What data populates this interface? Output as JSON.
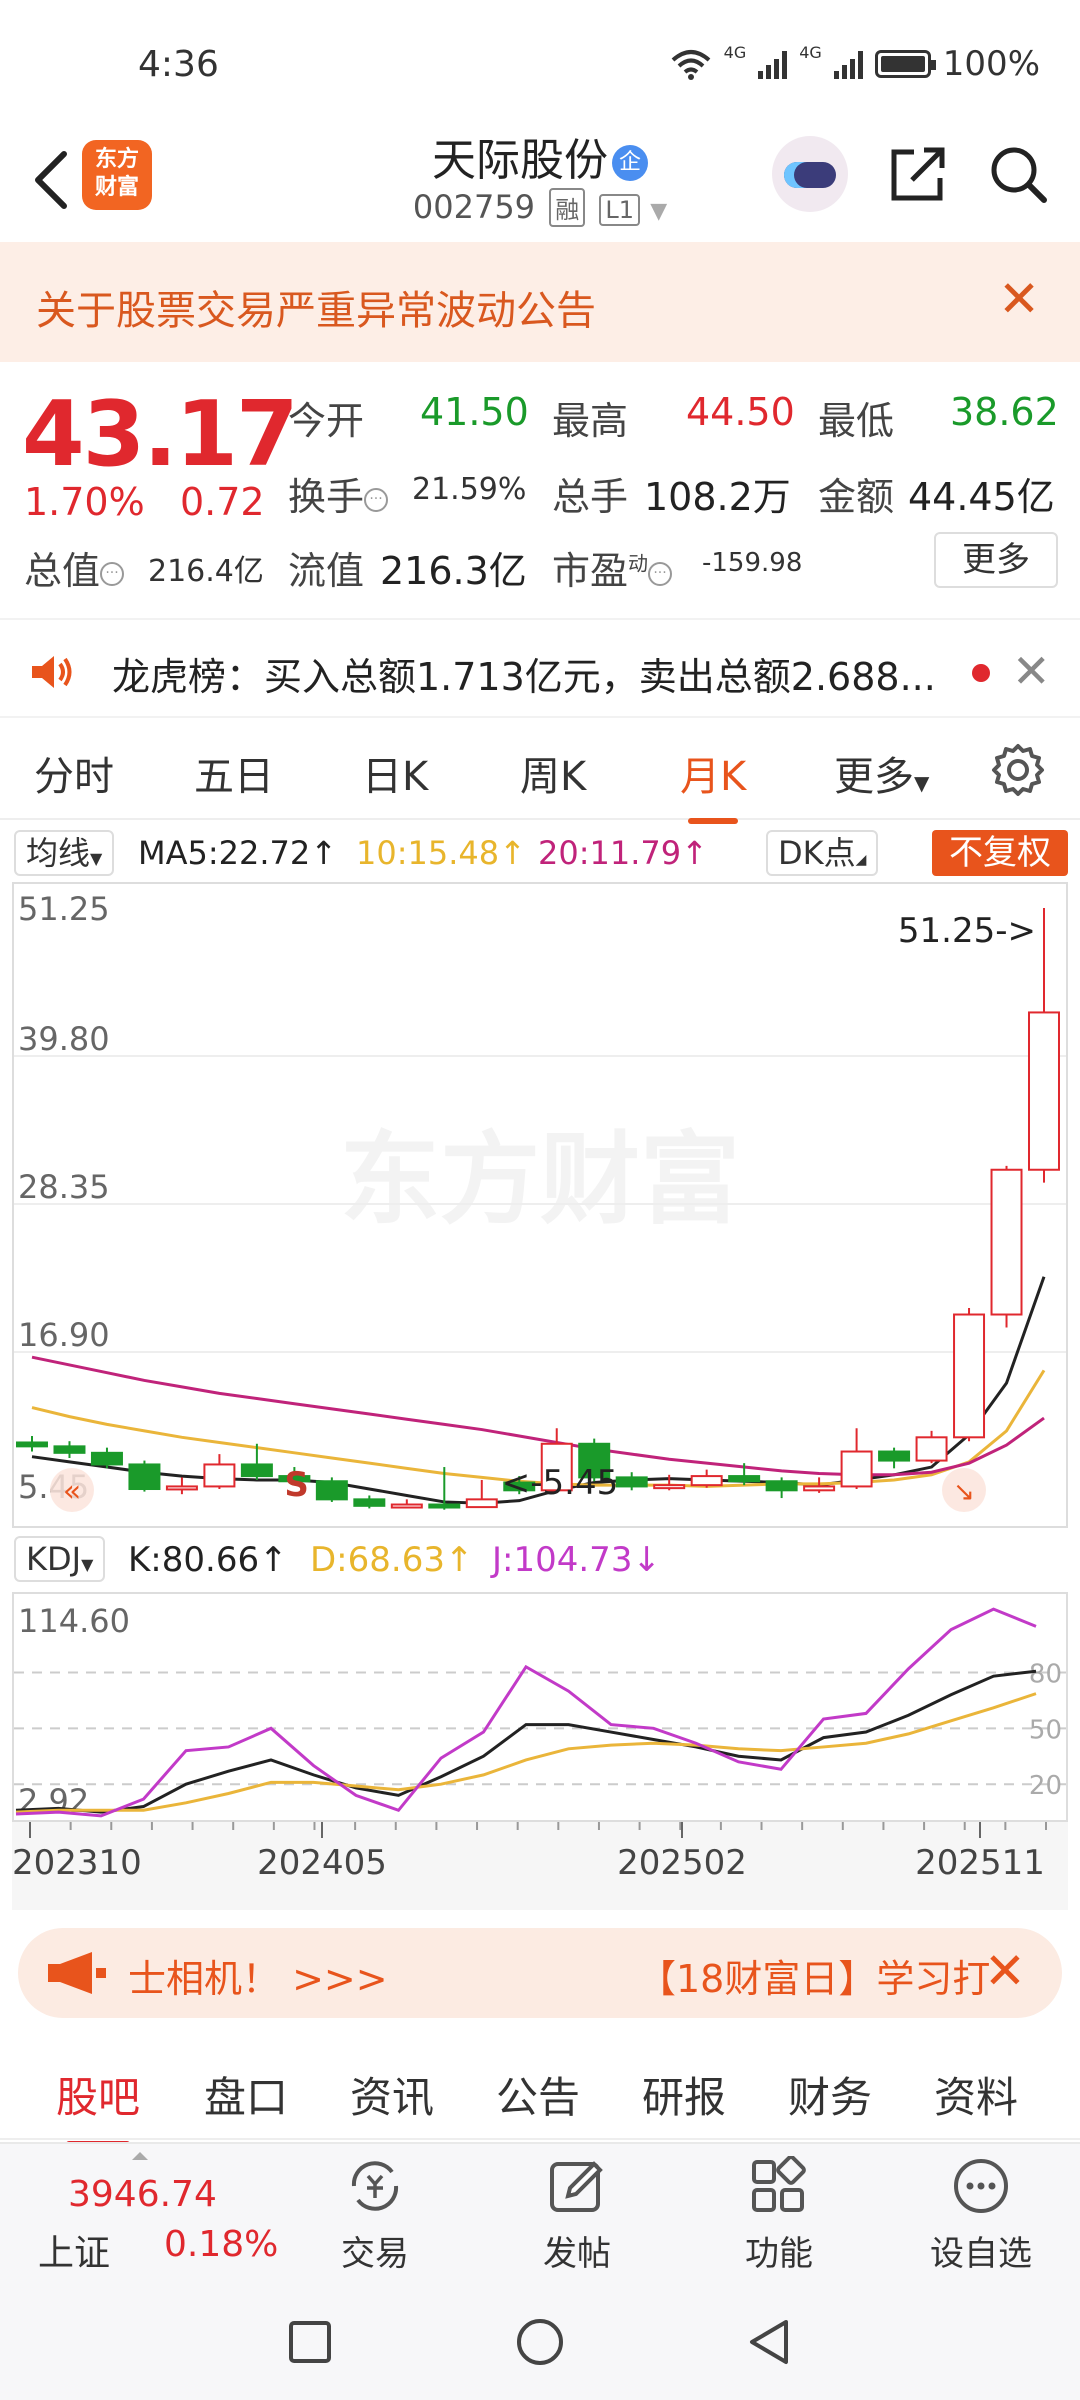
{
  "status": {
    "time": "4:36",
    "net1": "4G",
    "net2": "4G",
    "battery": "100%"
  },
  "header": {
    "logo_line1": "东方",
    "logo_line2": "财富",
    "name": "天际股份",
    "badge": "企",
    "code": "002759",
    "tag1": "融",
    "tag2": "L1"
  },
  "notice": {
    "text": "关于股票交易严重异常波动公告"
  },
  "quote": {
    "price": "43.17",
    "pct": "1.70%",
    "change": "0.72",
    "open_label": "今开",
    "open": "41.50",
    "high_label": "最高",
    "high": "44.50",
    "low_label": "最低",
    "low": "38.62",
    "turnover_label": "换手",
    "turnover": "21.59%",
    "volume_label": "总手",
    "volume": "108.2万",
    "amount_label": "金额",
    "amount": "44.45亿",
    "mcap_label": "总值",
    "mcap": "216.4亿",
    "float_label": "流值",
    "float_val": "216.3亿",
    "pe_label": "市盈",
    "pe_sup": "动",
    "pe": "-159.98",
    "more": "更多"
  },
  "longhu": {
    "text": "龙虎榜：买入总额1.713亿元，卖出总额2.688..."
  },
  "tabs": [
    "分时",
    "五日",
    "日K",
    "周K",
    "月K",
    "更多"
  ],
  "ma": {
    "selector": "均线",
    "ma5": "MA5:22.72↑",
    "ma10": "10:15.48↑",
    "ma20": "20:11.79↑",
    "dk": "DK点",
    "fq": "不复权"
  },
  "kdj": {
    "selector": "KDJ",
    "k": "K:80.66↑",
    "d": "D:68.63↑",
    "j": "J:104.73↓"
  },
  "promo": {
    "left": "士相机！ >>>",
    "right": "【18财富日】学习打"
  },
  "bottom_tabs": [
    "股吧",
    "盘口",
    "资讯",
    "公告",
    "研报",
    "财务",
    "资料"
  ],
  "toolbar": {
    "index_value": "3946.74",
    "index_name": "上证",
    "index_pct": "0.18%",
    "trade": "交易",
    "post": "发帖",
    "func": "功能",
    "watch": "设自选"
  },
  "chart_data": [
    {
      "type": "candlestick",
      "title": "",
      "y_ticks": [
        "51.25",
        "39.80",
        "28.35",
        "16.90",
        "5.45"
      ],
      "ylim": [
        5.45,
        51.25
      ],
      "x_labels": [
        "202310",
        "202405",
        "202502",
        "202511"
      ],
      "annotations": [
        "51.25->",
        "<-5.45",
        "S"
      ],
      "watermark": "东方财富",
      "candles": [
        {
          "o": 9.9,
          "c": 9.6,
          "h": 10.4,
          "l": 9.2
        },
        {
          "o": 9.6,
          "c": 9.1,
          "h": 10.0,
          "l": 8.7
        },
        {
          "o": 9.1,
          "c": 8.2,
          "h": 9.5,
          "l": 7.9
        },
        {
          "o": 8.2,
          "c": 6.3,
          "h": 8.5,
          "l": 6.1
        },
        {
          "o": 6.3,
          "c": 6.5,
          "h": 7.2,
          "l": 5.9
        },
        {
          "o": 6.5,
          "c": 8.2,
          "h": 9.0,
          "l": 6.3
        },
        {
          "o": 8.2,
          "c": 7.3,
          "h": 9.8,
          "l": 7.0
        },
        {
          "o": 7.3,
          "c": 6.9,
          "h": 8.0,
          "l": 6.6
        },
        {
          "o": 6.9,
          "c": 5.5,
          "h": 7.2,
          "l": 5.3
        },
        {
          "o": 5.5,
          "c": 5.0,
          "h": 5.8,
          "l": 4.8
        },
        {
          "o": 5.0,
          "c": 5.1,
          "h": 5.5,
          "l": 4.8
        },
        {
          "o": 5.1,
          "c": 4.9,
          "h": 8.0,
          "l": 4.7
        },
        {
          "o": 4.9,
          "c": 5.5,
          "h": 7.0,
          "l": 5.45
        },
        {
          "o": 6.8,
          "c": 6.2,
          "h": 7.3,
          "l": 5.9
        },
        {
          "o": 6.2,
          "c": 9.8,
          "h": 11.0,
          "l": 6.0
        },
        {
          "o": 9.8,
          "c": 7.2,
          "h": 10.2,
          "l": 6.9
        },
        {
          "o": 7.2,
          "c": 6.5,
          "h": 7.6,
          "l": 6.2
        },
        {
          "o": 6.5,
          "c": 6.6,
          "h": 7.4,
          "l": 6.2
        },
        {
          "o": 6.6,
          "c": 7.3,
          "h": 7.8,
          "l": 6.4
        },
        {
          "o": 7.3,
          "c": 6.9,
          "h": 8.3,
          "l": 6.6
        },
        {
          "o": 6.9,
          "c": 6.2,
          "h": 7.2,
          "l": 5.6
        },
        {
          "o": 6.2,
          "c": 6.5,
          "h": 7.2,
          "l": 6.0
        },
        {
          "o": 6.5,
          "c": 9.2,
          "h": 11.0,
          "l": 6.3
        },
        {
          "o": 9.2,
          "c": 8.5,
          "h": 9.5,
          "l": 7.9
        },
        {
          "o": 8.5,
          "c": 10.3,
          "h": 10.8,
          "l": 8.3
        },
        {
          "o": 10.3,
          "c": 19.8,
          "h": 20.3,
          "l": 10.0
        },
        {
          "o": 19.8,
          "c": 31.0,
          "h": 31.3,
          "l": 18.8
        },
        {
          "o": 31.0,
          "c": 43.17,
          "h": 51.25,
          "l": 30.0
        }
      ],
      "series": [
        {
          "name": "MA5",
          "values": [
            8.8,
            8.4,
            8.0,
            7.6,
            7.3,
            7.1,
            7.0,
            7.0,
            6.8,
            6.3,
            5.8,
            5.3,
            5.2,
            5.4,
            6.2,
            6.8,
            7.0,
            7.1,
            7.0,
            6.9,
            6.8,
            6.6,
            7.0,
            7.4,
            8.0,
            10.5,
            14.5,
            22.72
          ]
        },
        {
          "name": "MA10",
          "values": [
            12.6,
            11.9,
            11.3,
            10.8,
            10.3,
            9.9,
            9.5,
            9.1,
            8.7,
            8.3,
            7.9,
            7.5,
            7.2,
            6.9,
            6.7,
            6.6,
            6.6,
            6.6,
            6.5,
            6.6,
            6.7,
            6.7,
            6.8,
            7.0,
            7.4,
            8.4,
            10.8,
            15.48
          ]
        },
        {
          "name": "MA20",
          "values": [
            16.5,
            15.9,
            15.3,
            14.7,
            14.2,
            13.7,
            13.3,
            12.9,
            12.5,
            12.1,
            11.7,
            11.3,
            10.9,
            10.4,
            9.9,
            9.4,
            9.0,
            8.6,
            8.3,
            8.0,
            7.7,
            7.5,
            7.4,
            7.4,
            7.6,
            8.3,
            9.7,
            11.79
          ]
        }
      ]
    },
    {
      "type": "line",
      "title": "",
      "y_ticks": [
        "114.60",
        "2.92"
      ],
      "right_ticks": [
        "80",
        "50",
        "20"
      ],
      "ylim": [
        2.92,
        114.6
      ],
      "series": [
        {
          "name": "K",
          "values": [
            6,
            7,
            5,
            8,
            20,
            27,
            33,
            25,
            18,
            14,
            24,
            35,
            52,
            52,
            48,
            44,
            40,
            35,
            33,
            45,
            48,
            57,
            68,
            78,
            80.66
          ]
        },
        {
          "name": "D",
          "values": [
            5,
            6,
            6,
            6,
            10,
            15,
            21,
            21,
            19,
            17,
            20,
            25,
            33,
            39,
            41,
            42,
            41,
            39,
            38,
            40,
            42,
            47,
            54,
            61,
            68.63
          ]
        },
        {
          "name": "J",
          "values": [
            4,
            5,
            3,
            12,
            38,
            40,
            50,
            30,
            14,
            6,
            34,
            48,
            83,
            70,
            52,
            50,
            42,
            32,
            28,
            55,
            58,
            82,
            103,
            114,
            104.73
          ]
        }
      ]
    }
  ]
}
